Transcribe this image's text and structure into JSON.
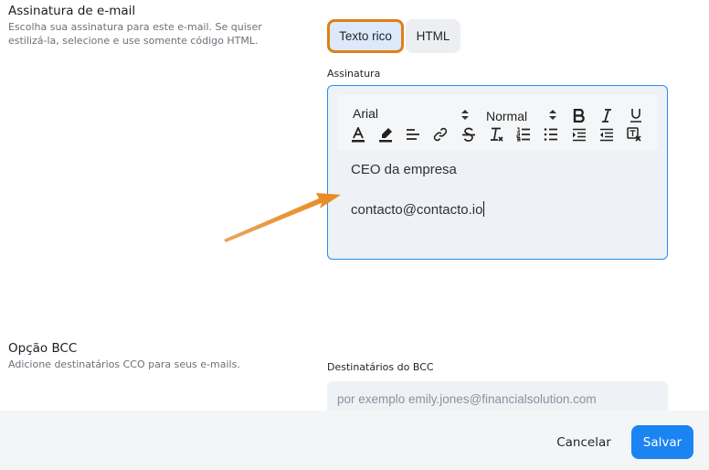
{
  "signature_section": {
    "title": "Assinatura de e-mail",
    "description_line1": "Escolha sua assinatura para este e-mail. Se quiser",
    "description_line2": "estilizá-la, selecione e use somente código HTML."
  },
  "mode_toggle": {
    "rich_text_label": "Texto rico",
    "html_label": "HTML",
    "selected": "Texto rico"
  },
  "editor": {
    "label": "Assinatura",
    "font_select": "Arial",
    "size_select": "Normal",
    "toolbar_icons": [
      "bold-icon",
      "italic-icon",
      "underline-icon",
      "font-color-icon",
      "highlight-icon",
      "align-left-icon",
      "link-icon",
      "strikethrough-icon",
      "clear-format-icon",
      "ordered-list-icon",
      "bullet-list-icon",
      "indent-icon",
      "outdent-icon",
      "remove-format-icon"
    ],
    "lines": [
      "CEO da empresa",
      "contacto@contacto.io"
    ]
  },
  "bcc_section": {
    "title": "Opção BCC",
    "description": "Adicione destinatários CCO para seus e-mails.",
    "field_label": "Destinatários do BCC",
    "placeholder": "por exemplo emily.jones@financialsolution.com",
    "value": ""
  },
  "footer": {
    "cancel_label": "Cancelar",
    "save_label": "Salvar"
  },
  "colors": {
    "accent": "#1a84f2",
    "highlight_border": "#e07f1a",
    "annotation_arrow": "#e8912a"
  }
}
